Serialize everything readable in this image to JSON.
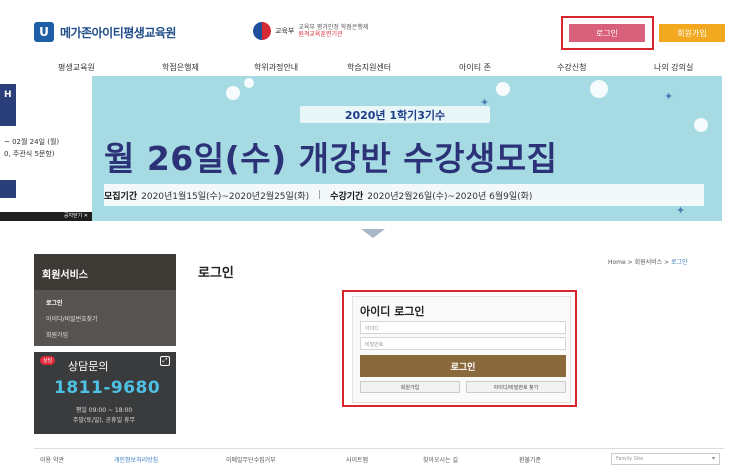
{
  "header": {
    "logo_text": "메가존아이티평생교육원",
    "gov_name": "교육부",
    "gov_desc_line1": "교육부 평가인정 학점은행제",
    "gov_desc_line2": "원격교육훈련기관",
    "login_label": "로그인",
    "join_label": "회원가입"
  },
  "gnb": {
    "items": [
      "평생교육원",
      "학점은행제",
      "학위과정안내",
      "학습지원센터",
      "아이티 존",
      "수강신청",
      "나의 강의실"
    ]
  },
  "banner": {
    "subtitle": "2020년 1학기3기수",
    "headline": "월 26일(수) 개강반 수강생모집",
    "recruit_label": "모집기간",
    "recruit_value": "2020년1월15일(수)~2020년2월25일(화)",
    "study_label": "수강기간",
    "study_value": "2020년2월26일(수)~2020년 6월9일(화)",
    "side_line1": "~ 02월 24일 (월)",
    "side_line2": "0, 주관식 5문항)",
    "side_close": "공지닫기"
  },
  "sidebar": {
    "title": "회원서비스",
    "items": [
      "로그인",
      "아이디/비밀번호찾기",
      "회원가입"
    ]
  },
  "consult": {
    "badge": "상담",
    "title": "상담문의",
    "phone": "1811-9680",
    "hours": "평일 09:00 ~ 18:00",
    "holiday": "주말(토/일), 공휴일 휴무"
  },
  "main": {
    "page_title": "로그인",
    "breadcrumb_home": "Home",
    "breadcrumb_section": "회원서비스",
    "breadcrumb_current": "로그인"
  },
  "login_form": {
    "title": "아이디 로그인",
    "id_placeholder": "아이디",
    "pw_placeholder": "비밀번호",
    "submit_label": "로그인",
    "join_label": "회원가입",
    "find_label": "아이디/비밀번호 찾기"
  },
  "footer": {
    "items": [
      "이용 약관",
      "개인정보처리방침",
      "이메일무단수집거부",
      "사이트맵",
      "찾아오시는 길",
      "환불기준"
    ],
    "family_site": "Family Site"
  },
  "colors": {
    "accent_login": "#d9607b",
    "accent_join": "#f2a920",
    "highlight_border": "#d8242b",
    "banner_bg": "#a7dbe3",
    "submit_bg": "#8a6a3c",
    "phone_color": "#4cc1e4"
  }
}
